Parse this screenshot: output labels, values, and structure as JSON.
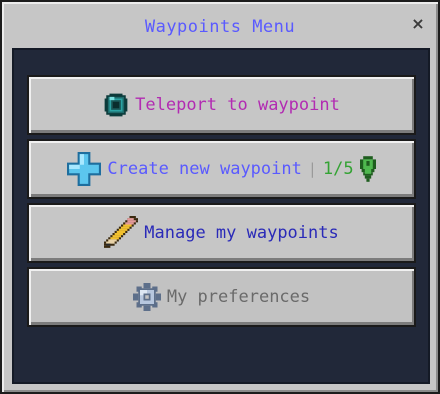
{
  "window": {
    "title": "Waypoints Menu",
    "close_label": "×"
  },
  "buttons": {
    "teleport": {
      "label": "Teleport to waypoint",
      "icon": "ender-pearl-icon",
      "color": "#b22bb2"
    },
    "create": {
      "label": "Create new waypoint",
      "icon": "plus-icon",
      "color": "#5a5aff",
      "separator": "|",
      "count": "1/5",
      "count_icon": "map-pin-icon",
      "count_color": "#34a334"
    },
    "manage": {
      "label": "Manage my waypoints",
      "icon": "pencil-icon",
      "color": "#2a2ab8"
    },
    "preferences": {
      "label": "My preferences",
      "icon": "gear-icon",
      "color": "#6a6a6a"
    }
  },
  "colors": {
    "window_bg": "#c6c6c6",
    "panel_bg": "#212839"
  }
}
